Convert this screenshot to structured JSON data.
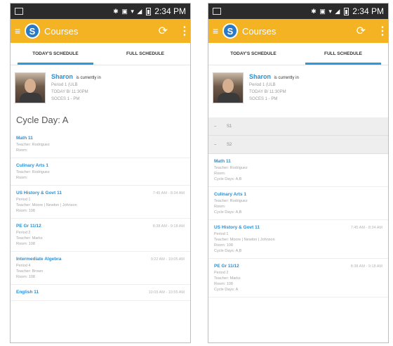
{
  "status_bar": {
    "time": "2:34 PM",
    "signal_glyphs": "✱ ▣ ▾ ◢"
  },
  "app": {
    "title": "Courses",
    "logo_letter": "S",
    "menu_glyph": "≡",
    "sync_glyph": "⟳",
    "more_glyph": "⋮"
  },
  "tabs": {
    "today": "TODAY'S SCHEDULE",
    "full": "FULL SCHEDULE"
  },
  "profile": {
    "name": "Sharon",
    "status": "is currently in",
    "lines": [
      "Period 1 (ULB",
      "TODAY B/ 11:30PM",
      "SOCES 1 - PM"
    ]
  },
  "left": {
    "cycle_label": "Cycle Day: A",
    "courses": [
      {
        "name": "Math 11",
        "lines": [
          "Teacher: Rodriguez",
          "Room:"
        ],
        "time": ""
      },
      {
        "name": "Culinary Arts 1",
        "lines": [
          "Teacher: Rodriguez",
          "Room:"
        ],
        "time": ""
      },
      {
        "name": "US History & Govt 11",
        "lines": [
          "Period 1",
          "Teacher: Moore | Newton | Johnson",
          "Room: 108"
        ],
        "time": "7:45 AM - 8:34 AM"
      },
      {
        "name": "PE Gr 11/12",
        "lines": [
          "Period 2",
          "Teacher: Marks",
          "Room: 108"
        ],
        "time": "8:38 AM - 9:18 AM"
      },
      {
        "name": "Intermediate Algebra",
        "lines": [
          "Period 4",
          "Teacher: Brown",
          "Room: 108"
        ],
        "time": "9:22 AM - 10:05 AM"
      },
      {
        "name": "English 11",
        "lines": [],
        "time": "10:09 AM - 10:55 AM"
      }
    ]
  },
  "right": {
    "filters": [
      "S1",
      "S2"
    ],
    "courses": [
      {
        "name": "Math 11",
        "lines": [
          "Teacher: Rodriguez",
          "Room:",
          "Cycle Days: A,B"
        ],
        "time": ""
      },
      {
        "name": "Culinary Arts 1",
        "lines": [
          "Teacher: Rodriguez",
          "Room:",
          "Cycle Days: A,B"
        ],
        "time": ""
      },
      {
        "name": "US History & Govt 11",
        "lines": [
          "Period 1",
          "Teacher: Moore | Newton | Johnson",
          "Room: 108",
          "Cycle Days: A,B"
        ],
        "time": "7:45 AM - 8:34 AM"
      },
      {
        "name": "PE Gr 11/12",
        "lines": [
          "Period 2",
          "Teacher: Marks",
          "Room: 108",
          "Cycle Days: A"
        ],
        "time": "8:38 AM - 9:18 AM"
      }
    ]
  }
}
